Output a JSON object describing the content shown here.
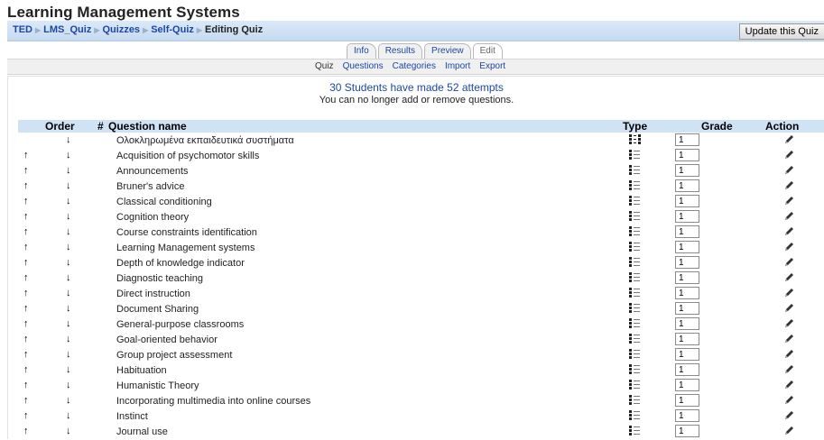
{
  "site": {
    "title": "Learning Management Systems"
  },
  "breadcrumb": [
    {
      "label": "TED",
      "link": true
    },
    {
      "label": "LMS_Quiz",
      "link": true
    },
    {
      "label": "Quizzes",
      "link": true
    },
    {
      "label": "Self-Quiz",
      "link": true
    },
    {
      "label": "Editing Quiz",
      "link": false
    }
  ],
  "header": {
    "update_button": "Update this Quiz"
  },
  "tabs": [
    {
      "label": "Info",
      "active": false
    },
    {
      "label": "Results",
      "active": false
    },
    {
      "label": "Preview",
      "active": false
    },
    {
      "label": "Edit",
      "active": true
    }
  ],
  "subtabs": [
    {
      "label": "Quiz",
      "current": true
    },
    {
      "label": "Questions",
      "current": false
    },
    {
      "label": "Categories",
      "current": false
    },
    {
      "label": "Import",
      "current": false
    },
    {
      "label": "Export",
      "current": false
    }
  ],
  "notice": {
    "attempts": "30 Students have made 52 attempts",
    "locked": "You can no longer add or remove questions."
  },
  "table": {
    "headers": {
      "order": "Order",
      "number": "#",
      "name": "Question name",
      "type": "Type",
      "grade": "Grade",
      "action": "Action"
    },
    "rows": [
      {
        "name": "Ολοκληρωμένα εκπαιδευτικά συστήματα",
        "up": false,
        "type": "random",
        "grade": "1"
      },
      {
        "name": "Acquisition of psychomotor skills",
        "up": true,
        "type": "multichoice",
        "grade": "1"
      },
      {
        "name": "Announcements",
        "up": true,
        "type": "multichoice",
        "grade": "1"
      },
      {
        "name": "Bruner's advice",
        "up": true,
        "type": "multichoice",
        "grade": "1"
      },
      {
        "name": "Classical conditioning",
        "up": true,
        "type": "multichoice",
        "grade": "1"
      },
      {
        "name": "Cognition theory",
        "up": true,
        "type": "multichoice",
        "grade": "1"
      },
      {
        "name": "Course constraints identification",
        "up": true,
        "type": "multichoice",
        "grade": "1"
      },
      {
        "name": "Learning Management systems",
        "up": true,
        "type": "multichoice",
        "grade": "1"
      },
      {
        "name": "Depth of knowledge indicator",
        "up": true,
        "type": "multichoice",
        "grade": "1"
      },
      {
        "name": "Diagnostic teaching",
        "up": true,
        "type": "multichoice",
        "grade": "1"
      },
      {
        "name": "Direct instruction",
        "up": true,
        "type": "multichoice",
        "grade": "1"
      },
      {
        "name": "Document Sharing",
        "up": true,
        "type": "multichoice",
        "grade": "1"
      },
      {
        "name": "General-purpose classrooms",
        "up": true,
        "type": "multichoice",
        "grade": "1"
      },
      {
        "name": "Goal-oriented behavior",
        "up": true,
        "type": "multichoice",
        "grade": "1"
      },
      {
        "name": "Group project assessment",
        "up": true,
        "type": "multichoice",
        "grade": "1"
      },
      {
        "name": "Habituation",
        "up": true,
        "type": "multichoice",
        "grade": "1"
      },
      {
        "name": "Humanistic Theory",
        "up": true,
        "type": "multichoice",
        "grade": "1"
      },
      {
        "name": "Incorporating multimedia into online courses",
        "up": true,
        "type": "multichoice",
        "grade": "1"
      },
      {
        "name": "Instinct",
        "up": true,
        "type": "multichoice",
        "grade": "1"
      },
      {
        "name": "Journal use",
        "up": true,
        "type": "multichoice",
        "grade": "1"
      }
    ]
  },
  "icons": {
    "move_up": "arrow-up-icon",
    "move_down": "arrow-down-icon",
    "type_random": "random-question-icon",
    "type_multichoice": "multichoice-icon",
    "edit": "edit-pencil-icon"
  },
  "colors": {
    "link": "#1c47a6",
    "navbar": "#c6daf0",
    "table_header": "#cfe3f5"
  }
}
